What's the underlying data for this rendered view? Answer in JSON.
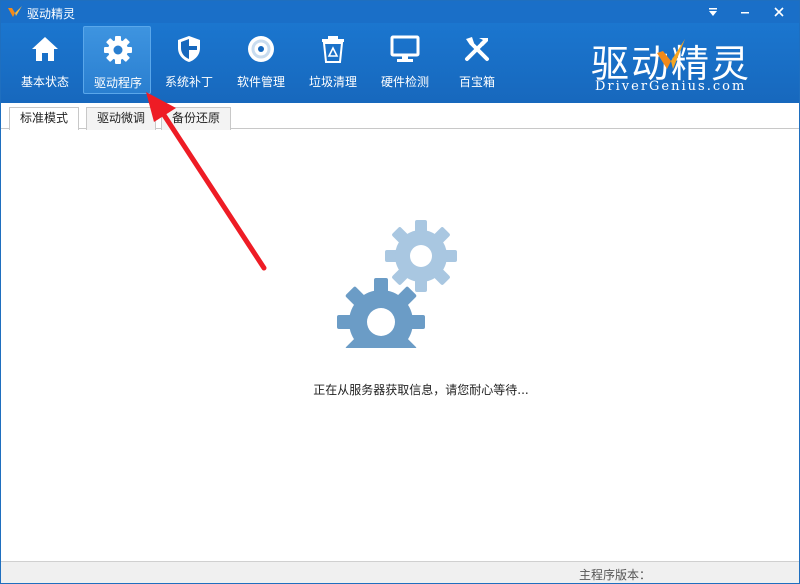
{
  "window": {
    "title": "驱动精灵"
  },
  "toolbar": {
    "items": [
      {
        "label": "基本状态",
        "icon": "home-icon",
        "active": false
      },
      {
        "label": "驱动程序",
        "icon": "gear-icon",
        "active": true
      },
      {
        "label": "系统补丁",
        "icon": "shield-icon",
        "active": false
      },
      {
        "label": "软件管理",
        "icon": "disc-icon",
        "active": false
      },
      {
        "label": "垃圾清理",
        "icon": "recycle-bin-icon",
        "active": false
      },
      {
        "label": "硬件检测",
        "icon": "monitor-icon",
        "active": false
      },
      {
        "label": "百宝箱",
        "icon": "tools-icon",
        "active": false
      }
    ]
  },
  "brand": {
    "name_cn": "驱动精灵",
    "name_en": "DriverGenius.com"
  },
  "tabs": [
    {
      "label": "标准模式",
      "active": true
    },
    {
      "label": "驱动微调",
      "active": false
    },
    {
      "label": "备份还原",
      "active": false
    }
  ],
  "content": {
    "loading_message": "正在从服务器获取信息，请您耐心等待..."
  },
  "status": {
    "version_label": "主程序版本："
  },
  "colors": {
    "titlebar": "#1a6fc8",
    "toolbar": "#1768bd",
    "gear_dark": "#6b9cc6",
    "gear_light": "#a9c7e1",
    "arrow": "#ee1c25"
  }
}
